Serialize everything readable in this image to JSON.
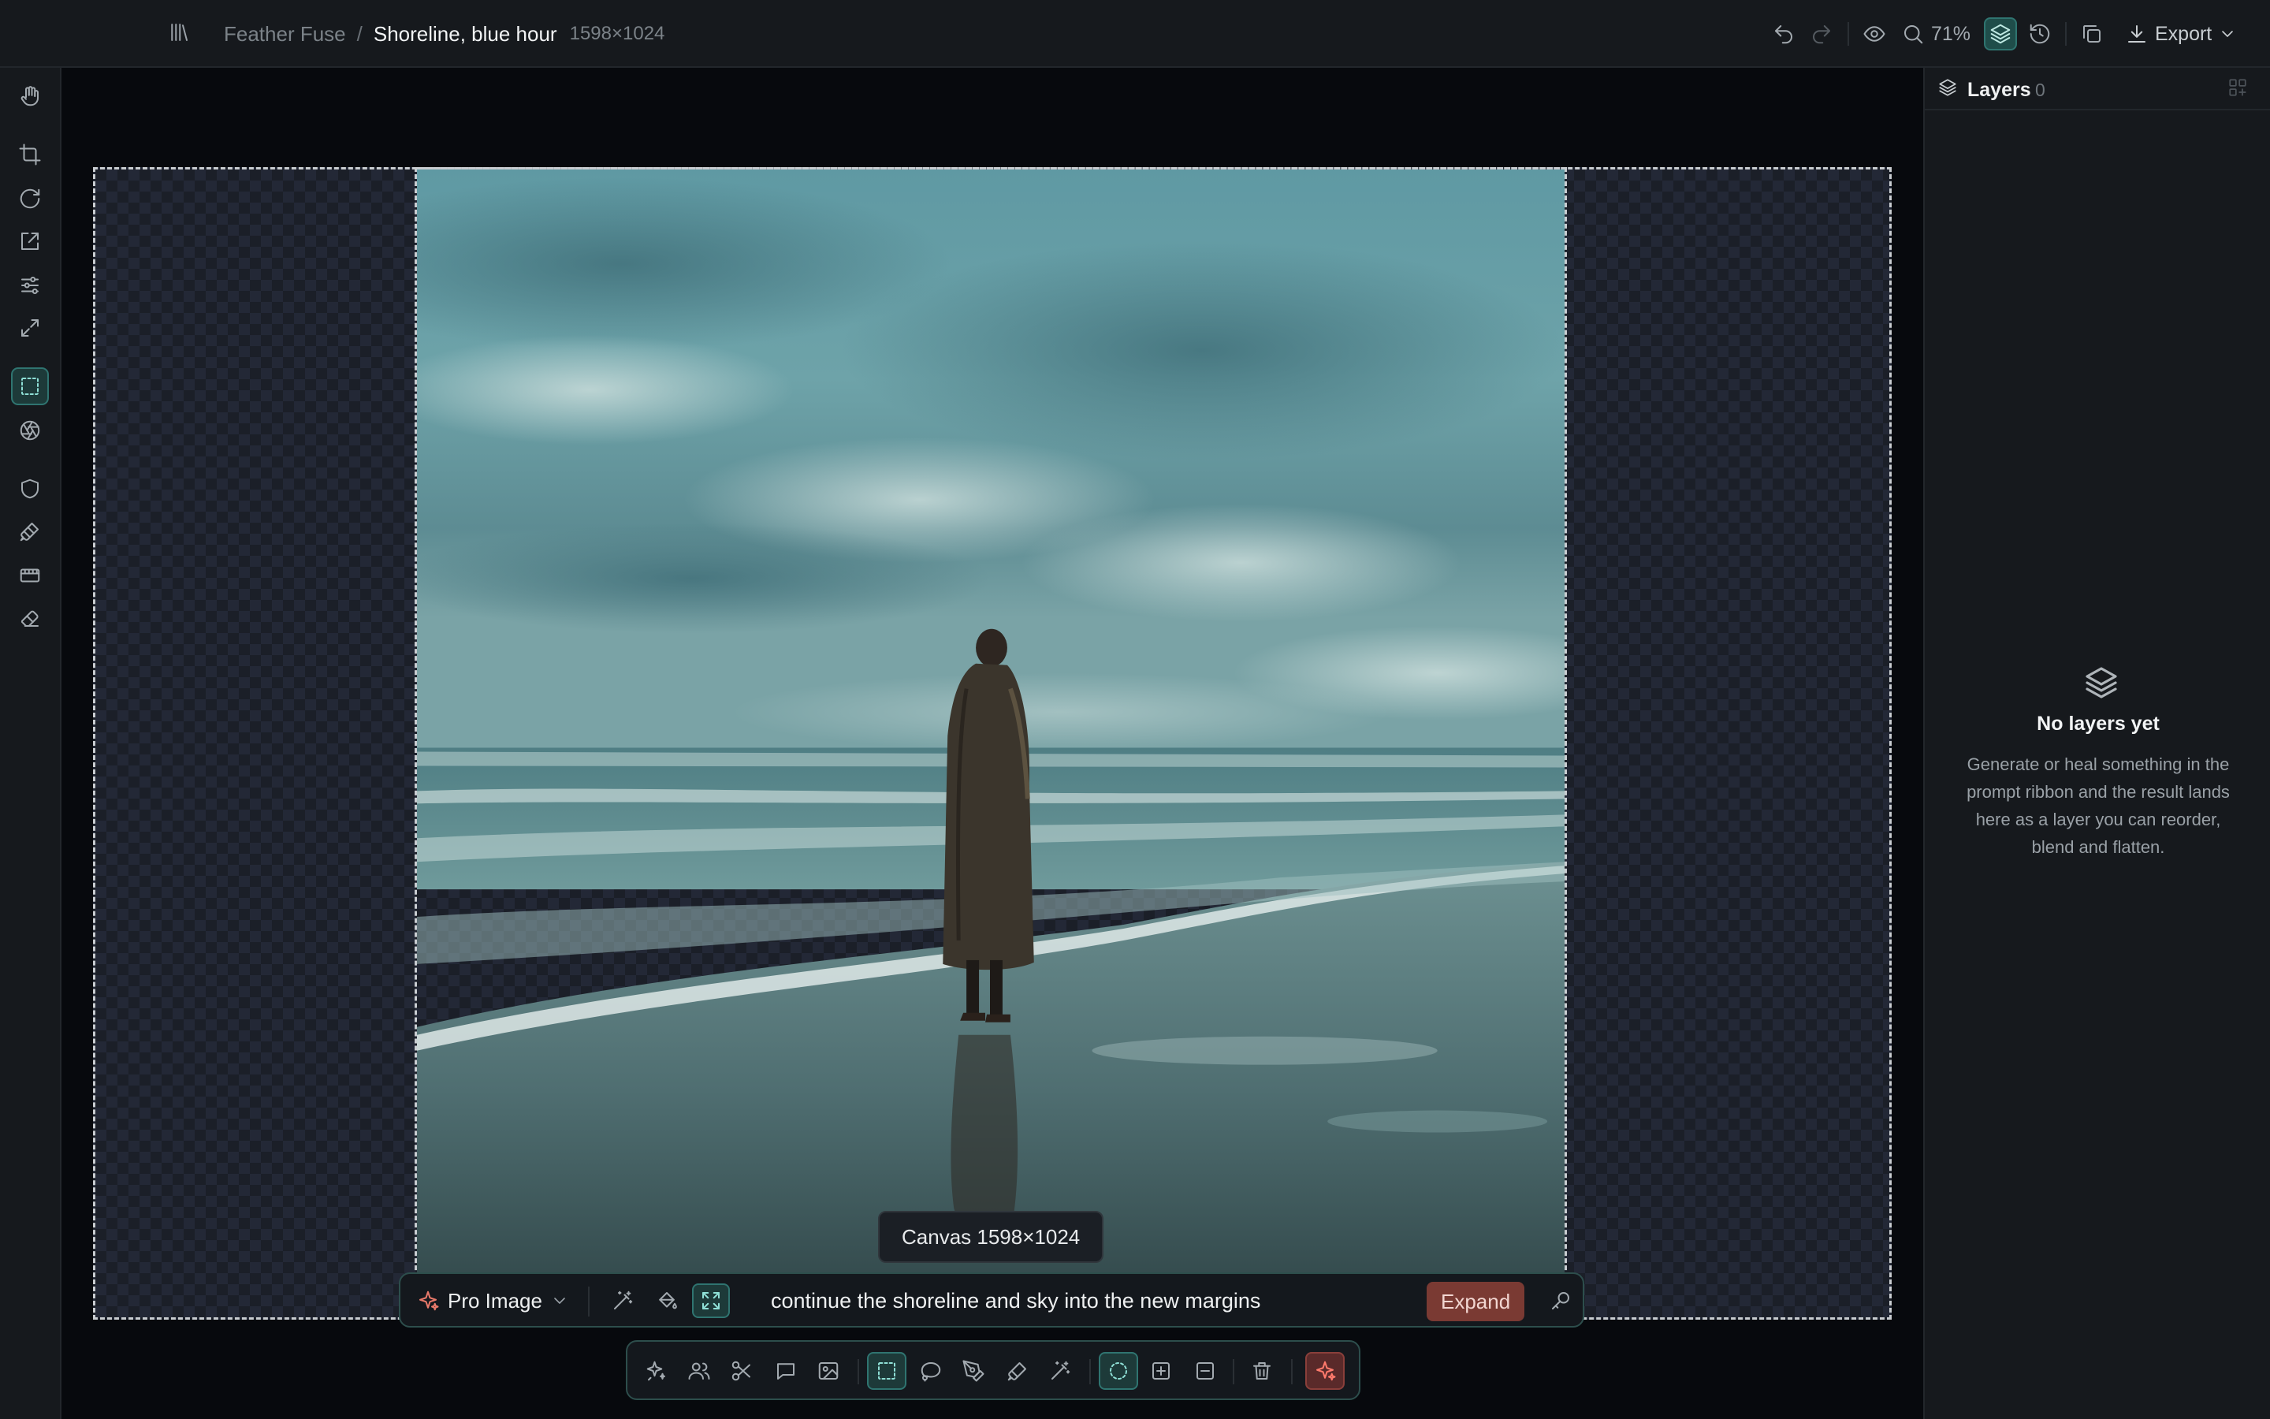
{
  "breadcrumb": {
    "project": "Feather Fuse",
    "separator": "/",
    "document": "Shoreline, blue hour",
    "dimensions": "1598×1024"
  },
  "topbar": {
    "zoom": "71%",
    "export_label": "Export"
  },
  "canvas": {
    "tag": "Canvas 1598×1024"
  },
  "ribbon": {
    "model": "Pro Image",
    "prompt": "continue the shoreline and sky into the new margins",
    "action": "Expand"
  },
  "layers": {
    "title": "Layers",
    "count": "0",
    "empty_title": "No layers yet",
    "empty_text": "Generate or heal something in the prompt ribbon and the result lands here as a layer you can reorder, blend and flatten."
  },
  "colors": {
    "accent": "#2f7470",
    "accent_fill": "#1d3a39",
    "danger": "#7a3a33"
  }
}
